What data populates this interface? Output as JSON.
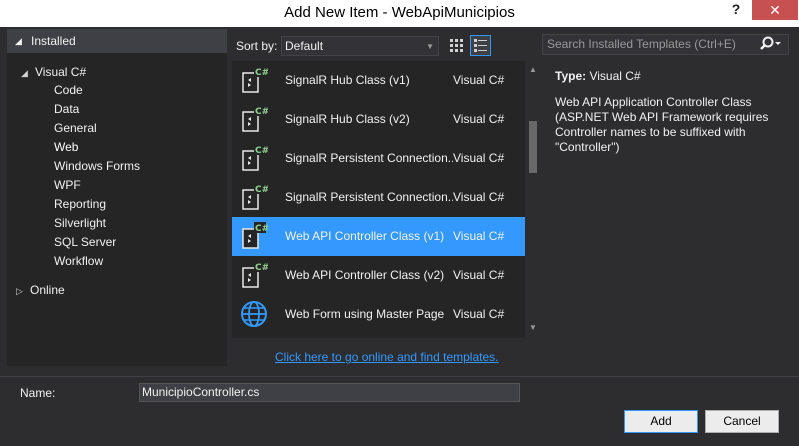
{
  "window": {
    "title": "Add New Item - WebApiMunicipios",
    "help": "?",
    "close": "✕"
  },
  "tree": {
    "installed": "Installed",
    "visual_csharp": "Visual C#",
    "children": [
      "Code",
      "Data",
      "General",
      "Web",
      "Windows Forms",
      "WPF",
      "Reporting",
      "Silverlight",
      "SQL Server",
      "Workflow"
    ],
    "selected": "Web",
    "online": "Online"
  },
  "toolbar": {
    "sort_by_label": "Sort by:",
    "sort_value": "Default",
    "search_placeholder": "Search Installed Templates (Ctrl+E)"
  },
  "templates": [
    {
      "name": "SignalR Hub Class (v1)",
      "lang": "Visual C#",
      "icon": "csharp-file-icon"
    },
    {
      "name": "SignalR Hub Class (v2)",
      "lang": "Visual C#",
      "icon": "csharp-file-icon"
    },
    {
      "name": "SignalR Persistent Connection...",
      "lang": "Visual C#",
      "icon": "csharp-file-icon"
    },
    {
      "name": "SignalR Persistent Connection...",
      "lang": "Visual C#",
      "icon": "csharp-file-icon"
    },
    {
      "name": "Web API Controller Class (v1)",
      "lang": "Visual C#",
      "icon": "csharp-file-icon",
      "selected": true
    },
    {
      "name": "Web API Controller Class (v2)",
      "lang": "Visual C#",
      "icon": "csharp-file-icon"
    },
    {
      "name": "Web Form using Master Page",
      "lang": "Visual C#",
      "icon": "globe-icon"
    }
  ],
  "info": {
    "type_label": "Type:",
    "type_value": "Visual C#",
    "description": "Web API Application Controller Class (ASP.NET Web API Framework requires Controller names to be suffixed with \"Controller\")"
  },
  "online_link": "Click here to go online and find templates.",
  "bottom": {
    "name_label": "Name:",
    "name_value": "MunicipioController.cs",
    "add_label": "Add",
    "cancel_label": "Cancel"
  },
  "colors": {
    "background": "#2d2d30",
    "selection": "#3399ff",
    "close_button": "#c75050",
    "link": "#3399ff"
  }
}
